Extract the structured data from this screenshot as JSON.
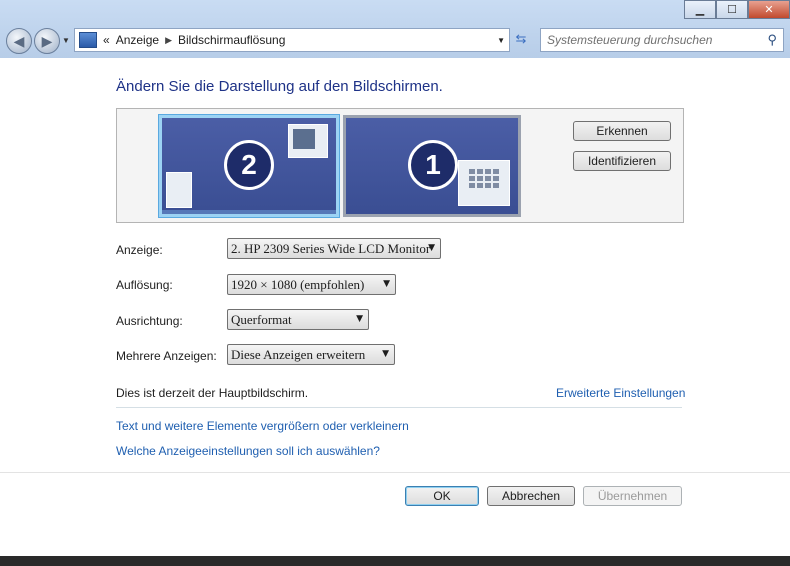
{
  "window": {
    "caption_buttons": {
      "minimize": "▁",
      "maximize": "☐",
      "close": "✕"
    }
  },
  "nav": {
    "back_icon": "back-arrow-icon",
    "forward_icon": "forward-arrow-icon",
    "address": {
      "prefix": "«",
      "crumbs": [
        "Anzeige",
        "Bildschirmauflösung"
      ],
      "separator": "▶"
    },
    "search_placeholder": "Systemsteuerung durchsuchen"
  },
  "main": {
    "heading": "Ändern Sie die Darstellung auf den Bildschirmen.",
    "monitors": [
      {
        "number": "2",
        "selected": true
      },
      {
        "number": "1",
        "selected": false
      }
    ],
    "detect_button": "Erkennen",
    "identify_button": "Identifizieren",
    "fields": {
      "display_label": "Anzeige:",
      "display_value": "2. HP 2309 Series Wide LCD Monitor",
      "resolution_label": "Auflösung:",
      "resolution_value": "1920 × 1080 (empfohlen)",
      "orientation_label": "Ausrichtung:",
      "orientation_value": "Querformat",
      "multiple_label": "Mehrere Anzeigen:",
      "multiple_value": "Diese Anzeigen erweitern"
    },
    "status": "Dies ist derzeit der Hauptbildschirm.",
    "advanced_link": "Erweiterte Einstellungen",
    "links": [
      "Text und weitere Elemente vergrößern oder verkleinern",
      "Welche Anzeigeeinstellungen soll ich auswählen?"
    ]
  },
  "footer": {
    "ok": "OK",
    "cancel": "Abbrechen",
    "apply": "Übernehmen"
  },
  "colors": {
    "heading": "#1e3287",
    "link": "#1f5fb0",
    "monitor_fill": "#3a4e93",
    "selected_border": "#9cd3f4"
  }
}
